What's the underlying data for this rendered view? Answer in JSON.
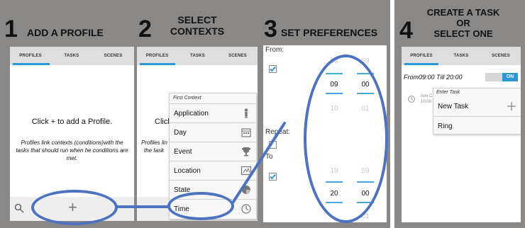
{
  "steps": {
    "s1": {
      "number": "1",
      "title": "ADD A PROFILE"
    },
    "s2": {
      "number": "2",
      "title_line1": "SELECT",
      "title_line2": "CONTEXTS"
    },
    "s3": {
      "number": "3",
      "title": "SET PREFERENCES"
    },
    "s4": {
      "number": "4",
      "title_line1": "CREATE A TASK",
      "title_line2": "OR",
      "title_line3": "SELECT ONE"
    }
  },
  "tabs": {
    "profiles": "PROFILES",
    "tasks": "TASKS",
    "scenes": "SCENES"
  },
  "panel1": {
    "click_text": "Click + to add a Profile.",
    "help_text": "Profiles link contexts (conditions)with the tasks that should run when he conditions are met.",
    "add_symbol": "+"
  },
  "panel2": {
    "partial_click": "Clicl",
    "partial_help_line1": "Profiles lin",
    "partial_help_line2": "the task",
    "menu_header": "First Context",
    "menu_items": [
      {
        "label": "Application",
        "icon": "person-icon"
      },
      {
        "label": "Day",
        "icon": "calendar-icon"
      },
      {
        "label": "Event",
        "icon": "trophy-icon"
      },
      {
        "label": "Location",
        "icon": "map-icon"
      },
      {
        "label": "State",
        "icon": "state-icon"
      },
      {
        "label": "Time",
        "icon": "clock-icon"
      }
    ]
  },
  "panel3": {
    "from_label": "From:",
    "repeat_label": "Repeat:",
    "to_label": "To",
    "from_hour_prev": "08",
    "from_min_prev": "59",
    "from_hour": "09",
    "from_min": "00",
    "from_hour_next": "10",
    "from_min_next": "01",
    "to_hour_prev": "19",
    "to_min_prev": "59",
    "to_hour": "20",
    "to_min": "00",
    "to_min_next": "01",
    "separator": ":"
  },
  "panel4": {
    "profile_text": "From09:00 Till 20:00",
    "toggle": "ON",
    "partial_left_line1": "rom C",
    "partial_left_line2": "10:00",
    "menu_header": "Enter Task",
    "menu_items": [
      {
        "label": "New Task",
        "icon": "plus-icon"
      },
      {
        "label": "Ring",
        "icon": ""
      }
    ]
  },
  "colors": {
    "accent": "#2a98d4",
    "highlight": "#4d73c0",
    "frame": "#8a8886"
  }
}
